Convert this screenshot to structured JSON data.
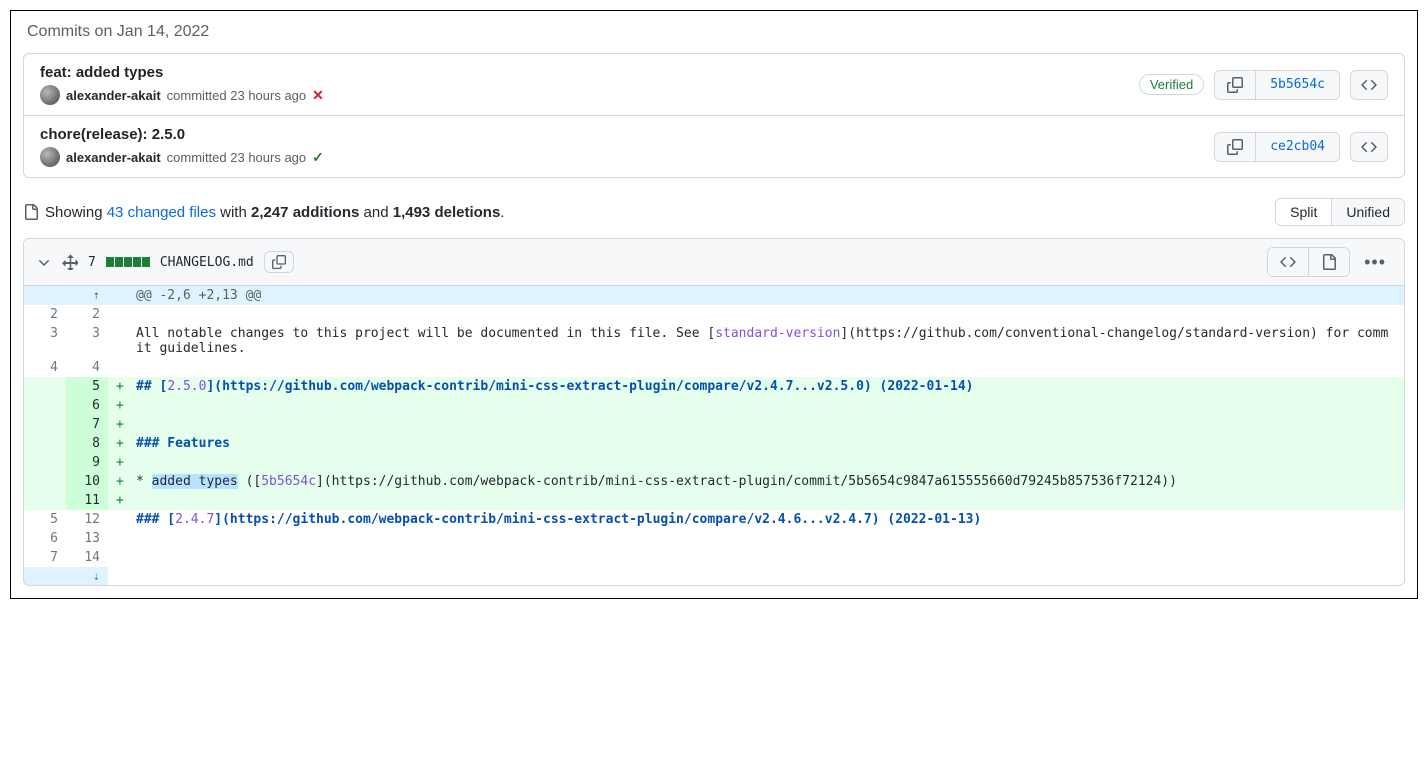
{
  "commits_header": "Commits on Jan 14, 2022",
  "commits": [
    {
      "title": "feat: added types",
      "author": "alexander-akait",
      "meta": " committed 23 hours ago",
      "status": "fail",
      "verified": true,
      "sha": "5b5654c"
    },
    {
      "title": "chore(release): 2.5.0",
      "author": "alexander-akait",
      "meta": " committed 23 hours ago",
      "status": "ok",
      "verified": false,
      "sha": "ce2cb04"
    }
  ],
  "summary": {
    "prefix": "Showing ",
    "changed": "43 changed files",
    "with": " with ",
    "additions": "2,247 additions",
    "and": " and ",
    "deletions": "1,493 deletions",
    "suffix": "."
  },
  "toggle": {
    "split": "Split",
    "unified": "Unified"
  },
  "file": {
    "count": "7",
    "name": "CHANGELOG.md"
  },
  "hunk": "@@ -2,6 +2,13 @@",
  "verified_label": "Verified",
  "l3_a": "All notable changes to this project will be documented in this file. See [",
  "l3_b": "standard-version",
  "l3_c": "](https://github.com/conventional-changelog/standard-version) for commit guidelines.",
  "l5_a": "## [",
  "l5_b": "2.5.0",
  "l5_c": "](https://github.com/webpack-contrib/mini-css-extract-plugin/compare/v2.4.7...v2.5.0) (2022-01-14)",
  "l8": "### Features",
  "l10_a": "* ",
  "l10_b": "added types",
  "l10_c": " ([",
  "l10_d": "5b5654c",
  "l10_e": "](https://github.com/webpack-contrib/mini-css-extract-plugin/commit/5b5654c9847a615555660d79245b857536f72124))",
  "l12_a": "### [",
  "l12_b": "2.4.7",
  "l12_c": "](https://github.com/webpack-contrib/mini-css-extract-plugin/compare/v2.4.6...v2.4.7) (2022-01-13)"
}
